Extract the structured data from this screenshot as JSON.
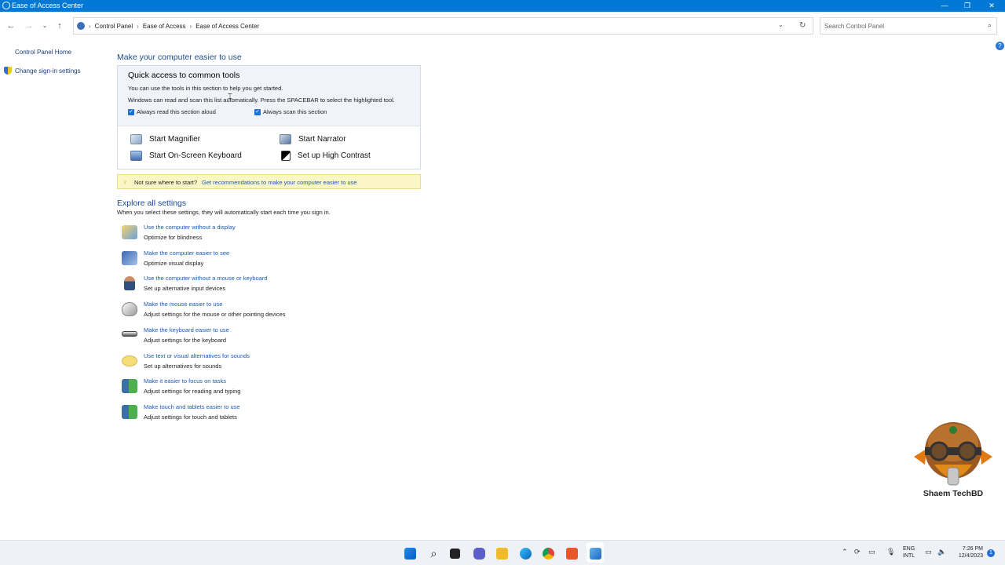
{
  "window": {
    "title": "Ease of Access Center",
    "minimize": "—",
    "maximize": "❐",
    "close": "✕"
  },
  "address_bar": {
    "breadcrumb": [
      "Control Panel",
      "Ease of Access",
      "Ease of Access Center"
    ],
    "separator": "›",
    "search_placeholder": "Search Control Panel"
  },
  "left_nav": {
    "home": "Control Panel Home",
    "sign_in": "Change sign-in settings"
  },
  "help_label": "?",
  "main": {
    "heading": "Make your computer easier to use",
    "quick_access": {
      "title": "Quick access to common tools",
      "line1": "You can use the tools in this section to help you get started.",
      "line2": "Windows can read and scan this list automatically.  Press the SPACEBAR to select the highlighted tool.",
      "check_read_aloud": "Always read this section aloud",
      "check_scan": "Always scan this section",
      "tools": {
        "magnifier": "Start Magnifier",
        "narrator": "Start Narrator",
        "keyboard": "Start On-Screen Keyboard",
        "contrast": "Set up High Contrast"
      }
    },
    "tip": {
      "question": "Not sure where to start?",
      "link": "Get recommendations to make your computer easier to use"
    },
    "explore": {
      "heading": "Explore all settings",
      "description": "When you select these settings, they will automatically start each time you sign in.",
      "items": [
        {
          "link": "Use the computer without a display",
          "desc": "Optimize for blindness",
          "icon": "display-icon"
        },
        {
          "link": "Make the computer easier to see",
          "desc": "Optimize visual display",
          "icon": "monitor-icon"
        },
        {
          "link": "Use the computer without a mouse or keyboard",
          "desc": "Set up alternative input devices",
          "icon": "person-icon"
        },
        {
          "link": "Make the mouse easier to use",
          "desc": "Adjust settings for the mouse or other pointing devices",
          "icon": "mouse-icon"
        },
        {
          "link": "Make the keyboard easier to use",
          "desc": "Adjust settings for the keyboard",
          "icon": "keyboard-icon"
        },
        {
          "link": "Use text or visual alternatives for sounds",
          "desc": "Set up alternatives for sounds",
          "icon": "speech-bubble-icon"
        },
        {
          "link": "Make it easier to focus on tasks",
          "desc": "Adjust settings for reading and typing",
          "icon": "user-focus-icon"
        },
        {
          "link": "Make touch and tablets easier to use",
          "desc": "Adjust settings for touch and tablets",
          "icon": "touch-icon"
        }
      ]
    }
  },
  "watermark": {
    "text": "Shaem TechBD"
  },
  "taskbar": {
    "lang_line1": "ENG",
    "lang_line2": "INTL",
    "time": "7:26 PM",
    "date": "12/4/2023",
    "notifications": "1"
  }
}
